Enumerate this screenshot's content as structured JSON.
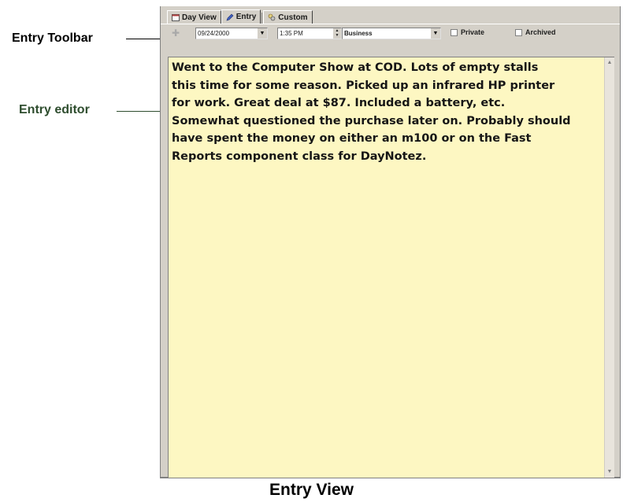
{
  "callouts": {
    "toolbar": "Entry Toolbar",
    "editor": "Entry editor"
  },
  "tabs": [
    {
      "label": "Day View",
      "icon": "calendar-icon"
    },
    {
      "label": "Entry",
      "icon": "pen-icon"
    },
    {
      "label": "Custom",
      "icon": "custom-view-icon"
    }
  ],
  "toolbar": {
    "date": "09/24/2000",
    "time": "1:35 PM",
    "category": "Business",
    "private_label": "Private",
    "archived_label": "Archived"
  },
  "editor": {
    "text": "Went to the Computer Show at COD. Lots of empty stalls\nthis time for some reason. Picked up an infrared HP printer\nfor work. Great deal at $87. Included a battery, etc.\nSomewhat questioned the purchase later on. Probably should\nhave spent the money on either an m100 or on the Fast\nReports component class for DayNotez."
  },
  "caption": "Entry View",
  "colors": {
    "editor_background": "#fdf7c2",
    "window_chrome": "#d4d0c8"
  }
}
